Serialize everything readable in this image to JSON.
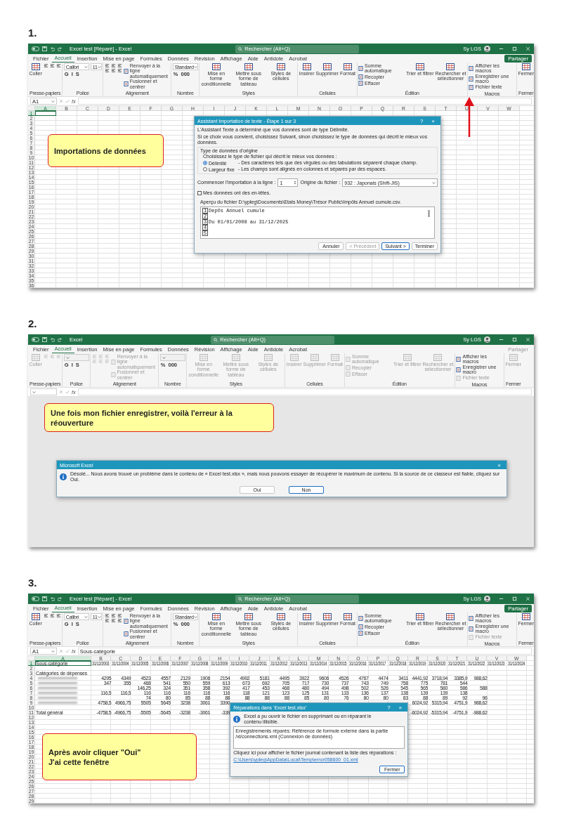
{
  "panels": [
    {
      "number": "1.",
      "title": "Excel test [Réparé] - Excel",
      "search_placeholder": "Rechercher (Alt+Q)",
      "user": "Sy LGS",
      "share": {
        "label": "Partager",
        "disabled": false
      },
      "menu": [
        {
          "label": "Fichier",
          "selected": false
        },
        {
          "label": "Accueil",
          "selected": true
        },
        {
          "label": "Insertion",
          "selected": false
        },
        {
          "label": "Mise en page",
          "selected": false
        },
        {
          "label": "Formules",
          "selected": false
        },
        {
          "label": "Données",
          "selected": false
        },
        {
          "label": "Révision",
          "selected": false
        },
        {
          "label": "Affichage",
          "selected": false
        },
        {
          "label": "Aide",
          "selected": false
        },
        {
          "label": "Antidote",
          "selected": false
        },
        {
          "label": "Acrobat",
          "selected": false
        }
      ],
      "ribbon": [
        {
          "label": "Presse-papiers",
          "columns": [
            [
              {
                "kind": "large",
                "label": "Coller",
                "disabled": false
              }
            ],
            [
              {
                "kind": "icons",
                "disabled": false
              }
            ]
          ]
        },
        {
          "label": "Police",
          "columns": [
            [
              {
                "kind": "fields",
                "values": [
                  "Calibri",
                  "11"
                ],
                "disabled": false
              },
              {
                "kind": "keys",
                "keys": [
                  "G",
                  "I",
                  "S"
                ],
                "disabled": false
              }
            ]
          ]
        },
        {
          "label": "Alignement",
          "columns": [
            [
              {
                "kind": "icons",
                "disabled": false
              },
              {
                "kind": "icons",
                "disabled": false
              }
            ],
            [
              {
                "kind": "small",
                "label": "Renvoyer à la ligne automatiquement",
                "disabled": false
              },
              {
                "kind": "small",
                "label": "Fusionner et centrer",
                "disabled": false
              }
            ]
          ]
        },
        {
          "label": "Nombre",
          "columns": [
            [
              {
                "kind": "fields",
                "values": [
                  "Standard"
                ],
                "disabled": false
              },
              {
                "kind": "keys",
                "keys": [
                  "%",
                  "000"
                ],
                "disabled": false
              }
            ]
          ]
        },
        {
          "label": "Styles",
          "columns": [
            [
              {
                "kind": "large",
                "label": "Mise en forme conditionnelle",
                "disabled": false
              }
            ],
            [
              {
                "kind": "large",
                "label": "Mettre sous forme de tableau",
                "disabled": false
              }
            ],
            [
              {
                "kind": "large",
                "label": "Styles de cellules",
                "disabled": false
              }
            ]
          ]
        },
        {
          "label": "Cellules",
          "columns": [
            [
              {
                "kind": "large",
                "label": "Insérer",
                "disabled": false
              }
            ],
            [
              {
                "kind": "large",
                "label": "Supprimer",
                "disabled": false
              }
            ],
            [
              {
                "kind": "large",
                "label": "Format",
                "disabled": false
              }
            ]
          ]
        },
        {
          "label": "Édition",
          "columns": [
            [
              {
                "kind": "small",
                "label": "Somme automatique",
                "disabled": false
              },
              {
                "kind": "small",
                "label": "Recopier",
                "disabled": false
              },
              {
                "kind": "small",
                "label": "Effacer",
                "disabled": false
              }
            ],
            [
              {
                "kind": "large",
                "label": "Trier et filtrer",
                "disabled": false
              }
            ],
            [
              {
                "kind": "large",
                "label": "Rechercher et sélectionner",
                "disabled": false
              }
            ]
          ]
        },
        {
          "label": "Macros",
          "columns": [
            [
              {
                "kind": "small",
                "label": "Afficher les macros",
                "disabled": false
              },
              {
                "kind": "small",
                "label": "Enregistrer une macro",
                "disabled": false
              },
              {
                "kind": "small",
                "label": "Fichier texte",
                "disabled": false
              }
            ]
          ]
        },
        {
          "label": "Fermer",
          "columns": [
            [
              {
                "kind": "large",
                "label": "Fermer",
                "disabled": false
              }
            ]
          ]
        }
      ],
      "name_box": "A1",
      "fx_label": "fx",
      "sheet": {
        "columns": [
          {
            "label": "A",
            "selected": true
          },
          {
            "label": "B",
            "selected": false
          },
          {
            "label": "C",
            "selected": false
          },
          {
            "label": "D",
            "selected": false
          },
          {
            "label": "E",
            "selected": false
          },
          {
            "label": "F",
            "selected": false
          },
          {
            "label": "G",
            "selected": false
          },
          {
            "label": "H",
            "selected": false
          },
          {
            "label": "I",
            "selected": false
          },
          {
            "label": "J",
            "selected": false
          },
          {
            "label": "K",
            "selected": false
          },
          {
            "label": "L",
            "selected": false
          },
          {
            "label": "M",
            "selected": false
          },
          {
            "label": "N",
            "selected": false
          },
          {
            "label": "O",
            "selected": false
          },
          {
            "label": "P",
            "selected": false
          },
          {
            "label": "Q",
            "selected": false
          },
          {
            "label": "R",
            "selected": false
          },
          {
            "label": "S",
            "selected": false
          },
          {
            "label": "T",
            "selected": false
          },
          {
            "label": "U",
            "selected": false
          },
          {
            "label": "V",
            "selected": false
          },
          {
            "label": "W",
            "selected": false
          }
        ],
        "rows": [
          {
            "number": "1",
            "selected": true
          },
          {
            "number": "2",
            "selected": false
          },
          {
            "number": "3",
            "selected": false
          },
          {
            "number": "4",
            "selected": false
          },
          {
            "number": "5",
            "selected": false
          },
          {
            "number": "6",
            "selected": false
          },
          {
            "number": "7",
            "selected": false
          },
          {
            "number": "8",
            "selected": false
          },
          {
            "number": "9",
            "selected": false
          },
          {
            "number": "10",
            "selected": false
          },
          {
            "number": "11",
            "selected": false
          },
          {
            "number": "12",
            "selected": false
          },
          {
            "number": "13",
            "selected": false
          },
          {
            "number": "14",
            "selected": false
          },
          {
            "number": "15",
            "selected": false
          },
          {
            "number": "16",
            "selected": false
          },
          {
            "number": "17",
            "selected": false
          },
          {
            "number": "18",
            "selected": false
          },
          {
            "number": "19",
            "selected": false
          },
          {
            "number": "20",
            "selected": false
          },
          {
            "number": "21",
            "selected": false
          },
          {
            "number": "22",
            "selected": false
          },
          {
            "number": "23",
            "selected": false
          },
          {
            "number": "24",
            "selected": false
          },
          {
            "number": "25",
            "selected": false
          },
          {
            "number": "26",
            "selected": false
          },
          {
            "number": "27",
            "selected": false
          },
          {
            "number": "28",
            "selected": false
          },
          {
            "number": "29",
            "selected": false
          },
          {
            "number": "30",
            "selected": false
          },
          {
            "number": "31",
            "selected": false
          },
          {
            "number": "32",
            "selected": false
          },
          {
            "number": "33",
            "selected": false
          },
          {
            "number": "34",
            "selected": false
          },
          {
            "number": "35",
            "selected": false
          },
          {
            "number": "36",
            "selected": false
          }
        ]
      },
      "callout": {
        "lines": [
          "Importations de données"
        ]
      },
      "dialog": {
        "kind": "import",
        "title": "Assistant Importation de texte - Étape 1 sur 3",
        "help": "?",
        "close": "×",
        "intro": [
          "L'Assistant Texte a déterminé que vos données sont de type Délimité.",
          "Si ce choix vous convient, choisissez Suivant, sinon choisissez le type de données qui décrit le mieux vos données."
        ],
        "section": "Type de données d'origine",
        "prompt": "Choisissez le type de fichier qui décrit le mieux vos données :",
        "options": [
          {
            "label": "Délimité",
            "description": "- Des caractères tels que des virgules ou des tabulations séparent chaque champ.",
            "selected": true
          },
          {
            "label": "Largeur fixe",
            "description": "- Les champs sont alignés en colonnes et séparés par des espaces.",
            "selected": false
          }
        ],
        "start_label": "Commencer l'importation à la ligne :",
        "start_value": "1",
        "origin_label": "Origine du fichier :",
        "origin_value": "932 : Japonais (Shift-JIS)",
        "header_checkbox": {
          "label": "Mes données ont des en-têtes.",
          "checked": false
        },
        "preview_label": "Aperçu du fichier D:\\ypleg\\Documents\\Etats Money\\Trésor Public\\Impôts Annuel cumule.csv.",
        "preview_lines": [
          {
            "number": "1",
            "text": "DepOs Annuel cumule"
          },
          {
            "number": "2"
          },
          {
            "number": "3",
            "text": "Du 01/01/2008 au 31/12/2025"
          },
          {
            "number": "4"
          },
          {
            "number": "5"
          }
        ],
        "buttons": [
          {
            "label": "Annuler",
            "disabled": false,
            "default": false
          },
          {
            "label": "< Précédent",
            "disabled": true,
            "default": false
          },
          {
            "label": "Suivant >",
            "disabled": false,
            "default": true
          },
          {
            "label": "Terminer",
            "disabled": false,
            "default": false
          }
        ]
      }
    },
    {
      "number": "2.",
      "title": "Excel",
      "search_placeholder": "Rechercher (Alt+Q)",
      "user": "Sy LGS",
      "share": {
        "label": "Partager",
        "disabled": true
      },
      "menu": [
        {
          "label": "Fichier",
          "selected": false
        },
        {
          "label": "Accueil",
          "selected": true
        },
        {
          "label": "Insertion",
          "selected": false
        },
        {
          "label": "Mise en page",
          "selected": false
        },
        {
          "label": "Formules",
          "selected": false
        },
        {
          "label": "Données",
          "selected": false
        },
        {
          "label": "Révision",
          "selected": false
        },
        {
          "label": "Affichage",
          "selected": false
        },
        {
          "label": "Aide",
          "selected": false
        },
        {
          "label": "Antidote",
          "selected": false
        },
        {
          "label": "Acrobat",
          "selected": false
        }
      ],
      "ribbon": [
        {
          "label": "Presse-papiers",
          "columns": [
            [
              {
                "kind": "large",
                "label": "Coller",
                "disabled": true
              }
            ],
            [
              {
                "kind": "icons",
                "disabled": true
              }
            ]
          ]
        },
        {
          "label": "Police",
          "columns": [
            [
              {
                "kind": "fields",
                "disabled": true
              },
              {
                "kind": "keys",
                "keys": [
                  "G",
                  "I",
                  "S"
                ],
                "disabled": false
              }
            ]
          ]
        },
        {
          "label": "Alignement",
          "columns": [
            [
              {
                "kind": "icons",
                "disabled": true
              },
              {
                "kind": "icons",
                "disabled": true
              }
            ],
            [
              {
                "kind": "small",
                "label": "Renvoyer à la ligne automatiquement",
                "disabled": true
              },
              {
                "kind": "small",
                "label": "Fusionner et centrer",
                "disabled": true
              }
            ]
          ]
        },
        {
          "label": "Nombre",
          "columns": [
            [
              {
                "kind": "fields",
                "disabled": true
              },
              {
                "kind": "keys",
                "keys": [
                  "%",
                  "000"
                ],
                "disabled": false
              }
            ]
          ]
        },
        {
          "label": "Styles",
          "columns": [
            [
              {
                "kind": "large",
                "label": "Mise en forme conditionnelle",
                "disabled": true
              }
            ],
            [
              {
                "kind": "large",
                "label": "Mettre sous forme de tableau",
                "disabled": true
              }
            ],
            [
              {
                "kind": "large",
                "label": "Styles de cellules",
                "disabled": true
              }
            ]
          ]
        },
        {
          "label": "Cellules",
          "columns": [
            [
              {
                "kind": "large",
                "label": "Insérer",
                "disabled": true
              }
            ],
            [
              {
                "kind": "large",
                "label": "Supprimer",
                "disabled": true
              }
            ],
            [
              {
                "kind": "large",
                "label": "Format",
                "disabled": true
              }
            ]
          ]
        },
        {
          "label": "Édition",
          "columns": [
            [
              {
                "kind": "small",
                "label": "Somme automatique",
                "disabled": true
              },
              {
                "kind": "small",
                "label": "Recopier",
                "disabled": true
              },
              {
                "kind": "small",
                "label": "Effacer",
                "disabled": true
              }
            ],
            [
              {
                "kind": "large",
                "label": "Trier et filtrer",
                "disabled": true
              }
            ],
            [
              {
                "kind": "large",
                "label": "Rechercher et sélectionner",
                "disabled": true
              }
            ]
          ]
        },
        {
          "label": "Macros",
          "columns": [
            [
              {
                "kind": "small",
                "label": "Afficher les macros",
                "disabled": false
              },
              {
                "kind": "small",
                "label": "Enregistrer une macro",
                "disabled": false
              },
              {
                "kind": "small",
                "label": "Fichier texte",
                "disabled": true
              }
            ]
          ]
        },
        {
          "label": "Fermer",
          "columns": [
            [
              {
                "kind": "large",
                "label": "Fermer",
                "disabled": true
              }
            ]
          ]
        }
      ],
      "fx_label": "fx",
      "callout": {
        "lines": [
          "Une fois mon fichier enregistrer, voilà l'erreur à la réouverture"
        ]
      },
      "dialog": {
        "kind": "message",
        "title": "Microsoft Excel",
        "close": "×",
        "message": "Désolé... Nous avons trouvé un problème dans le contenu de « Excel test.xlsx », mais nous pouvons essayer de récupérer le maximum de contenu. Si la source de ce classeur est fiable, cliquez sur Oui.",
        "buttons": [
          {
            "label": "Oui",
            "default": false
          },
          {
            "label": "Non",
            "default": true
          }
        ]
      }
    },
    {
      "number": "3.",
      "title": "Excel test [Réparé] - Excel",
      "search_placeholder": "Rechercher (Alt+Q)",
      "user": "Sy LGS",
      "share": {
        "label": "Partager",
        "disabled": false
      },
      "menu": [
        {
          "label": "Fichier",
          "selected": false
        },
        {
          "label": "Accueil",
          "selected": true
        },
        {
          "label": "Insertion",
          "selected": false
        },
        {
          "label": "Mise en page",
          "selected": false
        },
        {
          "label": "Formules",
          "selected": false
        },
        {
          "label": "Données",
          "selected": false
        },
        {
          "label": "Révision",
          "selected": false
        },
        {
          "label": "Affichage",
          "selected": false
        },
        {
          "label": "Aide",
          "selected": false
        },
        {
          "label": "Antidote",
          "selected": false
        },
        {
          "label": "Acrobat",
          "selected": false
        }
      ],
      "ribbon": [
        {
          "label": "Presse-papiers",
          "columns": [
            [
              {
                "kind": "large",
                "label": "Coller",
                "disabled": false
              }
            ],
            [
              {
                "kind": "icons",
                "disabled": false
              }
            ]
          ]
        },
        {
          "label": "Police",
          "columns": [
            [
              {
                "kind": "fields",
                "values": [
                  "Calibri",
                  "11"
                ],
                "disabled": false
              },
              {
                "kind": "keys",
                "keys": [
                  "G",
                  "I",
                  "S"
                ],
                "disabled": false
              }
            ]
          ]
        },
        {
          "label": "Alignement",
          "columns": [
            [
              {
                "kind": "icons",
                "disabled": false
              },
              {
                "kind": "icons",
                "disabled": false
              }
            ],
            [
              {
                "kind": "small",
                "label": "Renvoyer à la ligne automatiquement",
                "disabled": false
              },
              {
                "kind": "small",
                "label": "Fusionner et centrer",
                "disabled": false
              }
            ]
          ]
        },
        {
          "label": "Nombre",
          "columns": [
            [
              {
                "kind": "fields",
                "values": [
                  "Standard"
                ],
                "disabled": false
              },
              {
                "kind": "keys",
                "keys": [
                  "%",
                  "000"
                ],
                "disabled": false
              }
            ]
          ]
        },
        {
          "label": "Styles",
          "columns": [
            [
              {
                "kind": "large",
                "label": "Mise en forme conditionnelle",
                "disabled": false
              }
            ],
            [
              {
                "kind": "large",
                "label": "Mettre sous forme de tableau",
                "disabled": false
              }
            ],
            [
              {
                "kind": "large",
                "label": "Styles de cellules",
                "disabled": false
              }
            ]
          ]
        },
        {
          "label": "Cellules",
          "columns": [
            [
              {
                "kind": "large",
                "label": "Insérer",
                "disabled": false
              }
            ],
            [
              {
                "kind": "large",
                "label": "Supprimer",
                "disabled": false
              }
            ],
            [
              {
                "kind": "large",
                "label": "Format",
                "disabled": false
              }
            ]
          ]
        },
        {
          "label": "Édition",
          "columns": [
            [
              {
                "kind": "small",
                "label": "Somme automatique",
                "disabled": false
              },
              {
                "kind": "small",
                "label": "Recopier",
                "disabled": false
              },
              {
                "kind": "small",
                "label": "Effacer",
                "disabled": false
              }
            ],
            [
              {
                "kind": "large",
                "label": "Trier et filtrer",
                "disabled": false
              }
            ],
            [
              {
                "kind": "large",
                "label": "Rechercher et sélectionner",
                "disabled": false
              }
            ]
          ]
        },
        {
          "label": "Macros",
          "columns": [
            [
              {
                "kind": "small",
                "label": "Afficher les macros",
                "disabled": false
              },
              {
                "kind": "small",
                "label": "Enregistrer une macro",
                "disabled": false
              },
              {
                "kind": "small",
                "label": "Fichier texte",
                "disabled": true
              }
            ]
          ]
        },
        {
          "label": "Fermer",
          "columns": [
            [
              {
                "kind": "large",
                "label": "Fermer",
                "disabled": false
              }
            ]
          ]
        }
      ],
      "name_box": "A1",
      "fx_label": "fx",
      "formula": "Sous-catégorie",
      "sheet": {
        "columns": [
          {
            "label": "A",
            "selected": true
          },
          {
            "label": "B",
            "selected": false
          },
          {
            "label": "C",
            "selected": false
          },
          {
            "label": "D",
            "selected": false
          },
          {
            "label": "E",
            "selected": false
          },
          {
            "label": "F",
            "selected": false
          },
          {
            "label": "G",
            "selected": false
          },
          {
            "label": "H",
            "selected": false
          },
          {
            "label": "I",
            "selected": false
          },
          {
            "label": "J",
            "selected": false
          },
          {
            "label": "K",
            "selected": false
          },
          {
            "label": "L",
            "selected": false
          },
          {
            "label": "M",
            "selected": false
          },
          {
            "label": "N",
            "selected": false
          },
          {
            "label": "O",
            "selected": false
          },
          {
            "label": "P",
            "selected": false
          },
          {
            "label": "Q",
            "selected": false
          },
          {
            "label": "R",
            "selected": false
          },
          {
            "label": "S",
            "selected": false
          },
          {
            "label": "T",
            "selected": false
          },
          {
            "label": "U",
            "selected": false
          },
          {
            "label": "V",
            "selected": false
          },
          {
            "label": "W",
            "selected": false
          }
        ],
        "rows": [
          {
            "number": "1",
            "selected": true,
            "redacted": false,
            "cells": [
              "Sous-catégorie",
              "31/12/2003",
              "31/12/2004",
              "31/12/2005",
              "31/12/2006",
              "31/12/2007",
              "31/12/2008",
              "31/12/2009",
              "31/12/2010",
              "31/12/2011",
              "31/12/2012",
              "31/12/2013",
              "31/12/2014",
              "31/12/2015",
              "31/12/2016",
              "31/12/2017",
              "31/12/2018",
              "31/12/2019",
              "31/12/2020",
              "31/12/2021",
              "31/12/2022",
              "31/12/2023",
              "31/12/2024"
            ]
          },
          {
            "number": "2",
            "selected": false,
            "redacted": false
          },
          {
            "number": "3",
            "selected": false,
            "redacted": false,
            "cells": [
              "Catégories de dépenses"
            ]
          },
          {
            "number": "4",
            "selected": false,
            "redacted": true,
            "cells": [
              null,
              "4295",
              "4349",
              "4523",
              "4557",
              "2129",
              "1906",
              "2154",
              "4902",
              "5181",
              "4495",
              "3922",
              "9606",
              "4526",
              "4767",
              "4474",
              "3411",
              "4441,92",
              "3718,94",
              "3385,9",
              "988,62"
            ]
          },
          {
            "number": "5",
            "selected": false,
            "redacted": true,
            "cells": [
              null,
              "347",
              "355",
              "468",
              "541",
              "550",
              "559",
              "613",
              "673",
              "692",
              "705",
              "717",
              "730",
              "737",
              "743",
              "749",
              "758",
              "775",
              "781",
              "544"
            ]
          },
          {
            "number": "6",
            "selected": false,
            "redacted": true,
            "cells": [
              null,
              null,
              null,
              "146,25",
              "324",
              "351",
              "358",
              "392",
              "417",
              "453",
              "468",
              "480",
              "494",
              "498",
              "502",
              "526",
              "545",
              "565",
              "580",
              "586",
              "588"
            ]
          },
          {
            "number": "7",
            "selected": false,
            "redacted": true,
            "cells": [
              null,
              "116,5",
              "116,5",
              "116",
              "116",
              "116",
              "116",
              "116",
              "118",
              "121",
              "123",
              "125",
              "131",
              "133",
              "136",
              "137",
              "138",
              "139",
              "139",
              "138"
            ]
          },
          {
            "number": "8",
            "selected": false,
            "redacted": true,
            "cells": [
              null,
              null,
              null,
              "74",
              "80",
              "85",
              "88",
              "88",
              "88",
              "88",
              "88",
              "85",
              "80",
              "76",
              "80",
              "80",
              "83",
              "88",
              "89",
              "92",
              "96"
            ]
          },
          {
            "number": "9",
            "selected": false,
            "redacted": true,
            "cells": [
              null,
              "4758,5",
              "4966,75",
              "5505",
              "5645",
              "3238",
              "3061",
              "3390",
              null,
              null,
              null,
              null,
              null,
              null,
              null,
              null,
              null,
              "6024,92",
              "5315,94",
              "4751,9",
              "988,62"
            ]
          },
          {
            "number": "10",
            "selected": false,
            "redacted": false
          },
          {
            "number": "11",
            "selected": false,
            "redacted": false,
            "cells": [
              "Total général",
              "-4758,5",
              "-4966,75",
              "-5505",
              "-5645",
              "-3238",
              "-3061",
              "-339",
              null,
              null,
              null,
              null,
              null,
              null,
              null,
              null,
              null,
              "-6024,92",
              "-5315,94",
              "-4751,9",
              "-988,62"
            ]
          },
          {
            "number": "12",
            "selected": false,
            "redacted": false
          },
          {
            "number": "13",
            "selected": false,
            "redacted": false
          },
          {
            "number": "14",
            "selected": false,
            "redacted": false
          },
          {
            "number": "15",
            "selected": false,
            "redacted": false
          },
          {
            "number": "16",
            "selected": false,
            "redacted": false
          },
          {
            "number": "17",
            "selected": false,
            "redacted": false
          },
          {
            "number": "18",
            "selected": false,
            "redacted": false
          },
          {
            "number": "19",
            "selected": false,
            "redacted": false
          },
          {
            "number": "20",
            "selected": false,
            "redacted": false
          },
          {
            "number": "21",
            "selected": false,
            "redacted": false
          },
          {
            "number": "22",
            "selected": false,
            "redacted": false
          },
          {
            "number": "23",
            "selected": false,
            "redacted": false
          },
          {
            "number": "24",
            "selected": false,
            "redacted": false
          },
          {
            "number": "25",
            "selected": false,
            "redacted": false
          },
          {
            "number": "26",
            "selected": false,
            "redacted": false
          },
          {
            "number": "27",
            "selected": false,
            "redacted": false
          },
          {
            "number": "28",
            "selected": false,
            "redacted": false
          },
          {
            "number": "29",
            "selected": false,
            "redacted": false
          }
        ]
      },
      "callout": {
        "lines": [
          "Après avoir cliquer \"Oui\"",
          "J'ai cette fenêtre"
        ]
      },
      "dialog": {
        "kind": "repair",
        "title": "Réparations dans 'Excel test.xlsx'",
        "help": "?",
        "close": "×",
        "message": "Excel a pu ouvrir le fichier en supprimant ou en réparant le contenu illisible.",
        "log": "Enregistrements réparés: Référence de formule externe dans la partie /xl/connections.xml (Connexion de données)",
        "link_label": "Cliquez ici pour afficher le fichier journal contenant la liste des réparations :",
        "link": "C:\\Users\\ypleg\\AppData\\Local\\Temp\\error058600_01.xml",
        "buttons": [
          {
            "label": "Fermer",
            "default": true
          }
        ]
      }
    }
  ]
}
